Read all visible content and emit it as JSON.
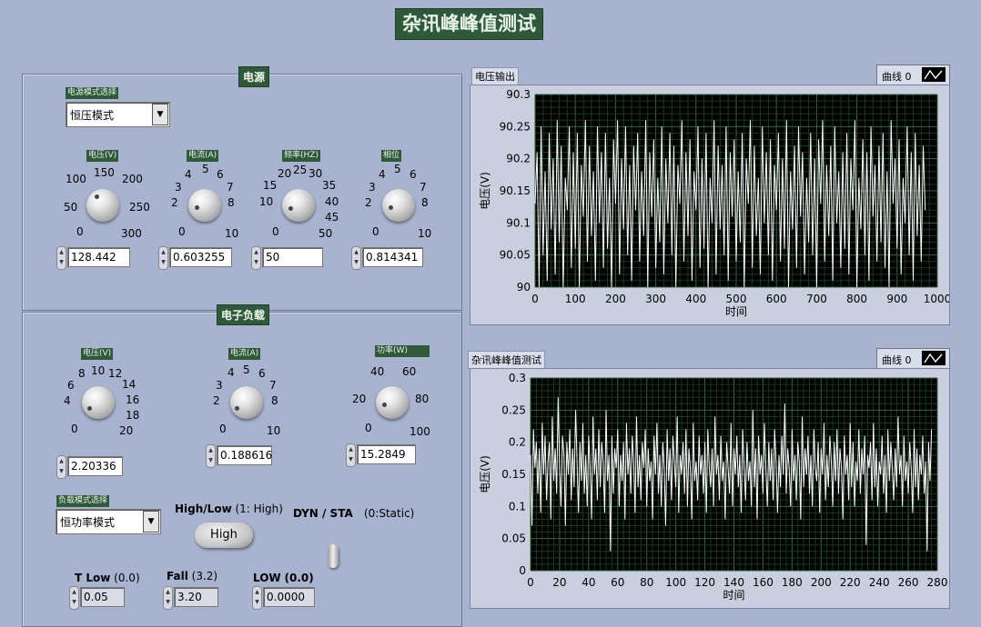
{
  "window_title": "杂讯峰峰值测试",
  "power": {
    "title": "电源",
    "mode_label": "电源模式选择",
    "mode_value": "恒压模式",
    "knobs": [
      {
        "label": "电压(V)",
        "ticks": [
          "0",
          "50",
          "100",
          "150",
          "200",
          "250",
          "300"
        ],
        "value": "128.442"
      },
      {
        "label": "电流(A)",
        "ticks": [
          "0",
          "2",
          "3",
          "4",
          "5",
          "6",
          "7",
          "8",
          "10"
        ],
        "value": "0.603255"
      },
      {
        "label": "频率(HZ)",
        "ticks": [
          "0",
          "10",
          "15",
          "20",
          "25",
          "30",
          "35",
          "40",
          "45",
          "50"
        ],
        "value": "50"
      },
      {
        "label": "相位",
        "ticks": [
          "0",
          "2",
          "3",
          "4",
          "5",
          "6",
          "7",
          "8",
          "10"
        ],
        "value": "0.814341"
      }
    ]
  },
  "load": {
    "title": "电子负载",
    "knobs": [
      {
        "label": "电压(V)",
        "ticks": [
          "0",
          "4",
          "6",
          "8",
          "10",
          "12",
          "14",
          "16",
          "18",
          "20"
        ],
        "value": "2.20336"
      },
      {
        "label": "电流(A)",
        "ticks": [
          "0",
          "2",
          "3",
          "4",
          "5",
          "6",
          "7",
          "8",
          "10"
        ],
        "value": "0.188616"
      },
      {
        "label": "功率(W)",
        "ticks": [
          "0",
          "20",
          "40",
          "60",
          "80",
          "100"
        ],
        "value": "15.2849"
      }
    ],
    "mode_label": "负载模式选择",
    "mode_value": "恒功率模式",
    "highlow_label": "High/Low",
    "highlow_hint": "(1: High)",
    "highlow_button": "High",
    "dyn_label": "DYN / STA",
    "dyn_hint": "(0:Static)",
    "tlow_label": "T Low",
    "tlow_hint": "(0.0)",
    "tlow_value": "0.05",
    "fall_label": "Fall",
    "fall_hint": "(3.2)",
    "fall_value": "3.20",
    "low_label": "LOW",
    "low_hint": "(0.0)",
    "low_value": "0.0000"
  },
  "chart_data": [
    {
      "type": "line",
      "title": "电压输出",
      "legend": "曲线 0",
      "xlabel": "时间",
      "ylabel": "电压(V)",
      "xlim": [
        0,
        1000
      ],
      "ylim": [
        90,
        90.3
      ],
      "x_ticks": [
        "0",
        "100",
        "200",
        "300",
        "400",
        "500",
        "600",
        "700",
        "800",
        "900",
        "1000"
      ],
      "y_ticks": [
        "90",
        "90.05",
        "90.1",
        "90.15",
        "90.2",
        "90.25",
        "90.3"
      ],
      "x_step": 5,
      "series": [
        {
          "values": [
            90.13,
            90.21,
            90.0,
            90.25,
            90.05,
            90.18,
            90.01,
            90.24,
            90.09,
            90.2,
            90.02,
            90.26,
            90.07,
            90.22,
            90.0,
            90.17,
            90.12,
            90.25,
            90.03,
            90.21,
            90.06,
            90.24,
            90.0,
            90.19,
            90.11,
            90.26,
            90.04,
            90.22,
            90.08,
            90.18,
            90.01,
            90.25,
            90.1,
            90.21,
            90.03,
            90.24,
            90.06,
            90.17,
            90.0,
            90.23,
            90.13,
            90.26,
            90.02,
            90.2,
            90.09,
            90.25,
            90.05,
            90.19,
            90.01,
            90.22,
            90.12,
            90.24,
            90.04,
            90.18,
            90.08,
            90.26,
            90.0,
            90.21,
            90.11,
            90.23,
            90.03,
            90.17,
            90.07,
            90.25,
            90.02,
            90.2,
            90.1,
            90.24,
            90.05,
            90.22,
            90.0,
            90.19,
            90.13,
            90.26,
            90.04,
            90.21,
            90.08,
            90.23,
            90.01,
            90.18,
            90.12,
            90.25,
            90.03,
            90.2,
            90.06,
            90.24,
            90.0,
            90.17,
            90.1,
            90.26,
            90.02,
            90.22,
            90.09,
            90.19,
            90.05,
            90.25,
            90.01,
            90.21,
            90.11,
            90.23,
            90.04,
            90.18,
            90.07,
            90.24,
            90.0,
            90.2,
            90.13,
            90.26,
            90.03,
            90.22,
            90.08,
            90.17,
            90.02,
            90.25,
            90.1,
            90.21,
            90.05,
            90.23,
            90.01,
            90.19,
            90.12,
            90.24,
            90.04,
            90.2,
            90.06,
            90.26,
            90.0,
            90.18,
            90.09,
            90.22,
            90.03,
            90.25,
            90.11,
            90.21,
            90.02,
            90.17,
            90.07,
            90.24,
            90.05,
            90.2,
            90.0,
            90.23,
            90.13,
            90.26,
            90.04,
            90.19,
            90.08,
            90.22,
            90.01,
            90.25,
            90.1,
            90.18,
            90.03,
            90.21,
            90.06,
            90.24,
            90.02,
            90.2,
            90.12,
            90.26,
            90.0,
            90.17,
            90.09,
            90.23,
            90.05,
            90.21,
            90.01,
            90.25,
            90.11,
            90.19,
            90.04,
            90.22,
            90.07,
            90.24,
            90.03,
            90.18,
            90.0,
            90.26,
            90.13,
            90.2,
            90.06,
            90.23,
            90.02,
            90.17,
            90.1,
            90.25,
            90.05,
            90.21,
            90.01,
            90.24,
            90.08,
            90.19,
            90.04,
            90.22,
            90.12
          ]
        }
      ]
    },
    {
      "type": "line",
      "title": "杂讯峰峰值测试",
      "legend": "曲线 0",
      "xlabel": "时间",
      "ylabel": "电压(V)",
      "xlim": [
        0,
        280
      ],
      "ylim": [
        0,
        0.3
      ],
      "x_ticks": [
        "0",
        "20",
        "40",
        "60",
        "80",
        "100",
        "120",
        "140",
        "160",
        "180",
        "200",
        "220",
        "240",
        "260",
        "280"
      ],
      "y_ticks": [
        "0",
        "0.05",
        "0.1",
        "0.15",
        "0.2",
        "0.25",
        "0.3"
      ],
      "x_step": 1,
      "series": [
        {
          "values": [
            0.18,
            0.07,
            0.22,
            0.16,
            0.2,
            0.12,
            0.19,
            0.09,
            0.23,
            0.15,
            0.21,
            0.11,
            0.17,
            0.2,
            0.08,
            0.24,
            0.14,
            0.19,
            0.12,
            0.27,
            0.16,
            0.1,
            0.21,
            0.18,
            0.07,
            0.2,
            0.15,
            0.22,
            0.11,
            0.19,
            0.13,
            0.25,
            0.17,
            0.09,
            0.2,
            0.14,
            0.23,
            0.12,
            0.18,
            0.1,
            0.21,
            0.16,
            0.08,
            0.24,
            0.15,
            0.19,
            0.11,
            0.22,
            0.13,
            0.2,
            0.17,
            0.09,
            0.25,
            0.14,
            0.18,
            0.03,
            0.21,
            0.12,
            0.19,
            0.16,
            0.22,
            0.1,
            0.18,
            0.14,
            0.2,
            0.08,
            0.23,
            0.15,
            0.19,
            0.12,
            0.21,
            0.17,
            0.09,
            0.24,
            0.13,
            0.18,
            0.11,
            0.2,
            0.16,
            0.22,
            0.1,
            0.19,
            0.14,
            0.17,
            0.08,
            0.21,
            0.15,
            0.23,
            0.12,
            0.18,
            0.1,
            0.2,
            0.16,
            0.07,
            0.22,
            0.14,
            0.19,
            0.11,
            0.21,
            0.17,
            0.13,
            0.24,
            0.09,
            0.18,
            0.15,
            0.2,
            0.12,
            0.22,
            0.1,
            0.19,
            0.16,
            0.08,
            0.23,
            0.14,
            0.17,
            0.11,
            0.21,
            0.15,
            0.18,
            0.12,
            0.2,
            0.09,
            0.22,
            0.16,
            0.13,
            0.19,
            0.1,
            0.24,
            0.15,
            0.18,
            0.11,
            0.21,
            0.14,
            0.17,
            0.08,
            0.2,
            0.16,
            0.12,
            0.23,
            0.1,
            0.19,
            0.15,
            0.21,
            0.13,
            0.18,
            0.09,
            0.22,
            0.16,
            0.11,
            0.2,
            0.14,
            0.17,
            0.1,
            0.25,
            0.13,
            0.19,
            0.08,
            0.21,
            0.15,
            0.18,
            0.12,
            0.23,
            0.16,
            0.1,
            0.2,
            0.14,
            0.19,
            0.11,
            0.22,
            0.17,
            0.09,
            0.18,
            0.13,
            0.21,
            0.15,
            0.26,
            0.12,
            0.19,
            0.16,
            0.1,
            0.22,
            0.14,
            0.18,
            0.11,
            0.2,
            0.17,
            0.08,
            0.24,
            0.13,
            0.19,
            0.15,
            0.21,
            0.12,
            0.18,
            0.1,
            0.22,
            0.16,
            0.14,
            0.2,
            0.09,
            0.19,
            0.15,
            0.23,
            0.11,
            0.18,
            0.13,
            0.21,
            0.17,
            0.1,
            0.2,
            0.14,
            0.22,
            0.12,
            0.19,
            0.16,
            0.08,
            0.21,
            0.15,
            0.18,
            0.11,
            0.23,
            0.13,
            0.2,
            0.1,
            0.17,
            0.14,
            0.22,
            0.12,
            0.19,
            0.15,
            0.21,
            0.04,
            0.18,
            0.16,
            0.2,
            0.11,
            0.23,
            0.13,
            0.19,
            0.1,
            0.17,
            0.15,
            0.21,
            0.12,
            0.18,
            0.09,
            0.22,
            0.14,
            0.2,
            0.16,
            0.11,
            0.19,
            0.13,
            0.24,
            0.15,
            0.18,
            0.1,
            0.21,
            0.14,
            0.17,
            0.12,
            0.2,
            0.16,
            0.09,
            0.22,
            0.13,
            0.19,
            0.11,
            0.18,
            0.15,
            0.21,
            0.12,
            0.17,
            0.03,
            0.2,
            0.14,
            0.22
          ]
        }
      ]
    }
  ]
}
